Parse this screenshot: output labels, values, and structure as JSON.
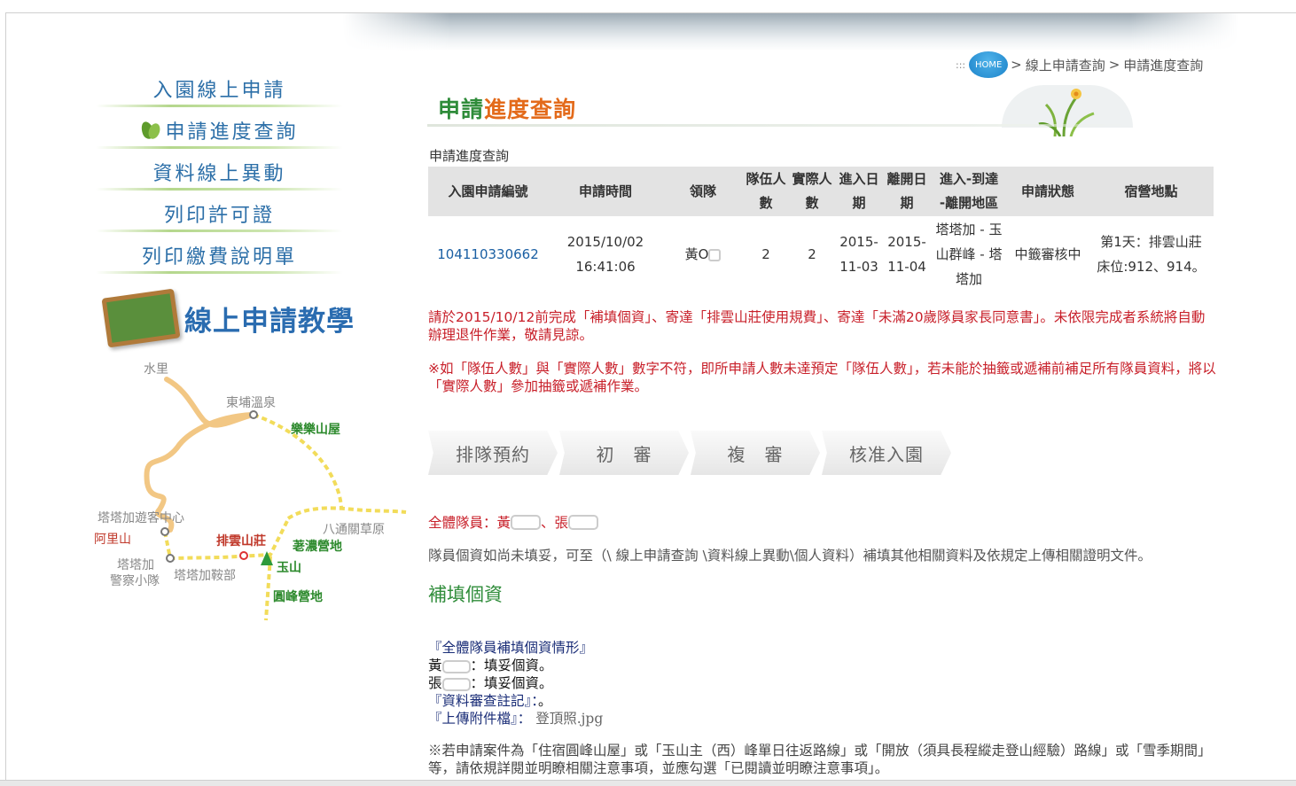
{
  "sidebar": {
    "menu": [
      "入園線上申請",
      "申請進度查詢",
      "資料線上異動",
      "列印許可證",
      "列印繳費說明單"
    ],
    "tutorial": "線上申請教學",
    "map_labels": {
      "shuili": "水里",
      "dongpu": "東埔溫泉",
      "lele": "樂樂山屋",
      "tataka_vc": "塔塔加遊客中心",
      "alishan": "阿里山",
      "paiyun": "排雲山莊",
      "batongguan": "八通關草原",
      "guanyu_camp": "荖濃營地",
      "tataka_police_1": "塔塔加",
      "tataka_police_2": "警察小隊",
      "tataka_hq": "塔塔加鞍部",
      "yushan": "玉山",
      "yuanfeng": "圓峰營地"
    }
  },
  "breadcrumb": {
    "prefix": ":::",
    "home": "HOME",
    "sep1": ">",
    "item1": "線上申請查詢",
    "sep2": ">",
    "item2": "申請進度查詢"
  },
  "title": {
    "part1": "申請",
    "part2": "進度查詢"
  },
  "section_label": "申請進度查詢",
  "table": {
    "headers": {
      "id": "入園申請編號",
      "time": "申請時間",
      "leader": "領隊",
      "team_a": "隊伍人",
      "team_b": "數",
      "actual_a": "實際人",
      "actual_b": "數",
      "enter_a": "進入日",
      "enter_b": "期",
      "leave_a": "離開日",
      "leave_b": "期",
      "route_a": "進入-到達",
      "route_b": "-離開地區",
      "status": "申請狀態",
      "lodging": "宿營地點"
    },
    "row": {
      "id": "104110330662",
      "time_a": "2015/10/02",
      "time_b": "16:41:06",
      "leader": "黃O",
      "team": "2",
      "actual": "2",
      "enter_a": "2015-",
      "enter_b": "11-03",
      "leave_a": "2015-",
      "leave_b": "11-04",
      "route_a": "塔塔加 - 玉",
      "route_b": "山群峰 - 塔",
      "route_c": "塔加",
      "status": "中籤審核中",
      "lodging_a": "第1天：排雲山莊",
      "lodging_b": "床位:912、914。"
    }
  },
  "warning1": "請於2015/10/12前完成「補填個資」、寄達「排雲山莊使用規費」、寄達「未滿20歲隊員家長同意書」。未依限完成者系統將自動辦理退件作業，敬請見諒。",
  "warning2": "※如「隊伍人數」與「實際人數」數字不符，即所申請人數未達預定「隊伍人數」，若未能於抽籤或遞補前補足所有隊員資料，將以「實際人數」參加抽籤或遞補作業。",
  "steps": [
    "排隊預約",
    "初　審",
    "複　審",
    "核准入園"
  ],
  "members": {
    "label": "全體隊員：",
    "m1": "黃",
    "sep": "、",
    "m2": "張"
  },
  "note": "隊員個資如尚未填妥，可至（\\ 線上申請查詢 \\資料線上異動\\個人資料）補填其他相關資料及依規定上傳相關證明文件。",
  "fill_link": "補填個資",
  "status_block": {
    "heading": "『全體隊員補填個資情形』",
    "m1_name": "黃",
    "m1_status": "：填妥個資。",
    "m2_name": "張",
    "m2_status": "：填妥個資。",
    "review_label": "『資料審查註記』：",
    "review_value": "。",
    "upload_label": "『上傳附件檔』：",
    "upload_value": "登頂照.jpg"
  },
  "final_note": "※若申請案件為「住宿圓峰山屋」或「玉山主（西）峰單日往返路線」或「開放（須具長程縱走登山經驗）路線」或「雪季期間」等，請依規詳閱並明瞭相關注意事項，並應勾選「已閱讀並明瞭注意事項」。",
  "colors": {
    "accent_green": "#2f8c3a",
    "accent_orange": "#e36a1a",
    "warning_red": "#c8202a",
    "link_blue": "#1a5fa3"
  }
}
